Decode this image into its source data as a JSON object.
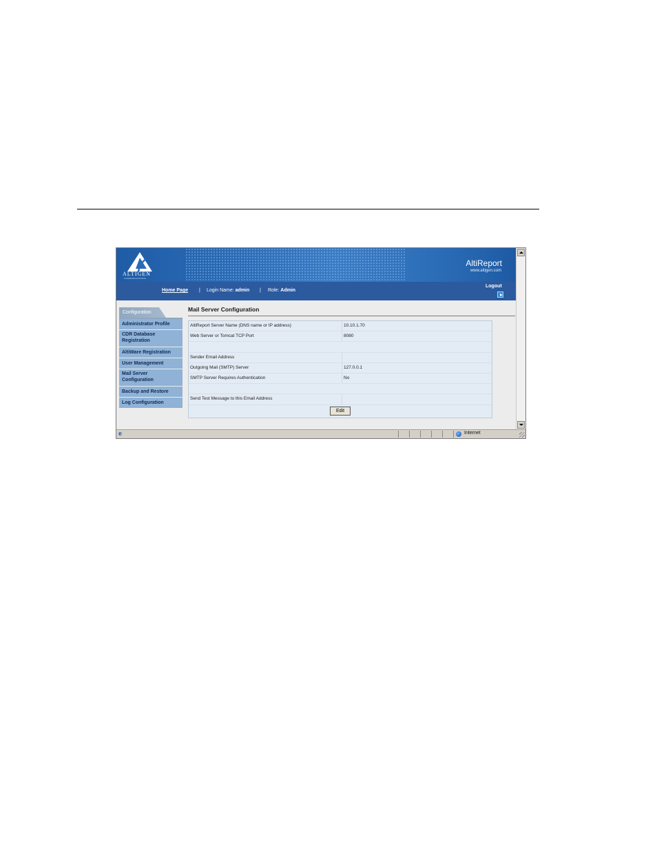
{
  "branding": {
    "logo_text": "ALTIGEN",
    "logo_subtext": "COMMUNICATIONS",
    "app_title": "AltiReport",
    "app_url": "www.altigen.com"
  },
  "navbar": {
    "home_link": "Home Page",
    "separator": "|",
    "login_label": "Login Name:",
    "login_value": "admin",
    "role_label": "Role:",
    "role_value": "Admin",
    "logout_label": "Logout"
  },
  "sidebar": {
    "section_tab": "Configuration",
    "items": [
      {
        "label": "Administrator Profile"
      },
      {
        "label": "CDR Database Registration"
      },
      {
        "label": "AltiWare Registration"
      },
      {
        "label": "User Management"
      },
      {
        "label": "Mail Server Configuration"
      },
      {
        "label": "Backup and Restore"
      },
      {
        "label": "Log Configuration"
      }
    ]
  },
  "main": {
    "title": "Mail Server Configuration",
    "rows": [
      {
        "label": "AltiReport Server Name (DNS name or IP address)",
        "value": "10.10.1.70"
      },
      {
        "label": "Web Server or Tomcat TCP Port",
        "value": "8080"
      },
      {
        "label": "",
        "value": ""
      },
      {
        "label": "Sender Email Address",
        "value": ""
      },
      {
        "label": "Outgoing Mail (SMTP) Server",
        "value": "127.0.0.1"
      },
      {
        "label": "SMTP Server Requires Authentication",
        "value": "No"
      },
      {
        "label": "",
        "value": ""
      },
      {
        "label": "Send Test Message to this Email Address",
        "value": ""
      }
    ],
    "edit_button": "Edit"
  },
  "statusbar": {
    "zone": "Internet"
  },
  "colors": {
    "banner": "#2a6bb6",
    "navbar": "#2b5a9f",
    "sidebar_item": "#8fb2d6",
    "table_row": "#e3ebf4"
  }
}
